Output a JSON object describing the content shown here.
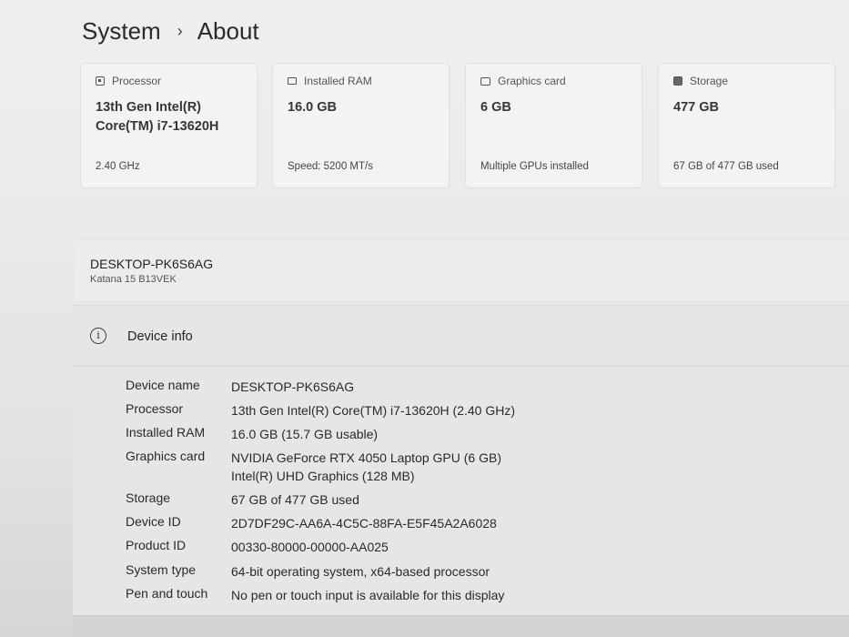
{
  "breadcrumb": {
    "parent": "System",
    "separator": "›",
    "current": "About"
  },
  "cards": [
    {
      "title": "Processor",
      "icon": "processor-icon",
      "value": "13th Gen Intel(R) Core(TM) i7-13620H",
      "sub": "2.40 GHz"
    },
    {
      "title": "Installed RAM",
      "icon": "ram-icon",
      "value": "16.0 GB",
      "sub": "Speed: 5200 MT/s"
    },
    {
      "title": "Graphics card",
      "icon": "graphics-card-icon",
      "value": "6 GB",
      "sub": "Multiple GPUs installed"
    },
    {
      "title": "Storage",
      "icon": "storage-icon",
      "value": "477 GB",
      "sub": "67 GB of 477 GB used"
    }
  ],
  "device": {
    "name": "DESKTOP-PK6S6AG",
    "model": "Katana 15 B13VEK"
  },
  "device_info": {
    "title": "Device info",
    "icon": "info-icon",
    "rows": [
      {
        "label": "Device name",
        "values": [
          "DESKTOP-PK6S6AG"
        ]
      },
      {
        "label": "Processor",
        "values": [
          "13th Gen Intel(R) Core(TM) i7-13620H (2.40 GHz)"
        ]
      },
      {
        "label": "Installed RAM",
        "values": [
          "16.0 GB (15.7 GB usable)"
        ]
      },
      {
        "label": "Graphics card",
        "values": [
          "NVIDIA GeForce RTX 4050 Laptop GPU (6 GB)",
          "Intel(R) UHD Graphics (128 MB)"
        ]
      },
      {
        "label": "Storage",
        "values": [
          "67 GB of 477 GB used"
        ]
      },
      {
        "label": "Device ID",
        "values": [
          "2D7DF29C-AA6A-4C5C-88FA-E5F45A2A6028"
        ]
      },
      {
        "label": "Product ID",
        "values": [
          "00330-80000-00000-AA025"
        ]
      },
      {
        "label": "System type",
        "values": [
          "64-bit operating system, x64-based processor"
        ]
      },
      {
        "label": "Pen and touch",
        "values": [
          "No pen or touch input is available for this display"
        ]
      }
    ]
  }
}
